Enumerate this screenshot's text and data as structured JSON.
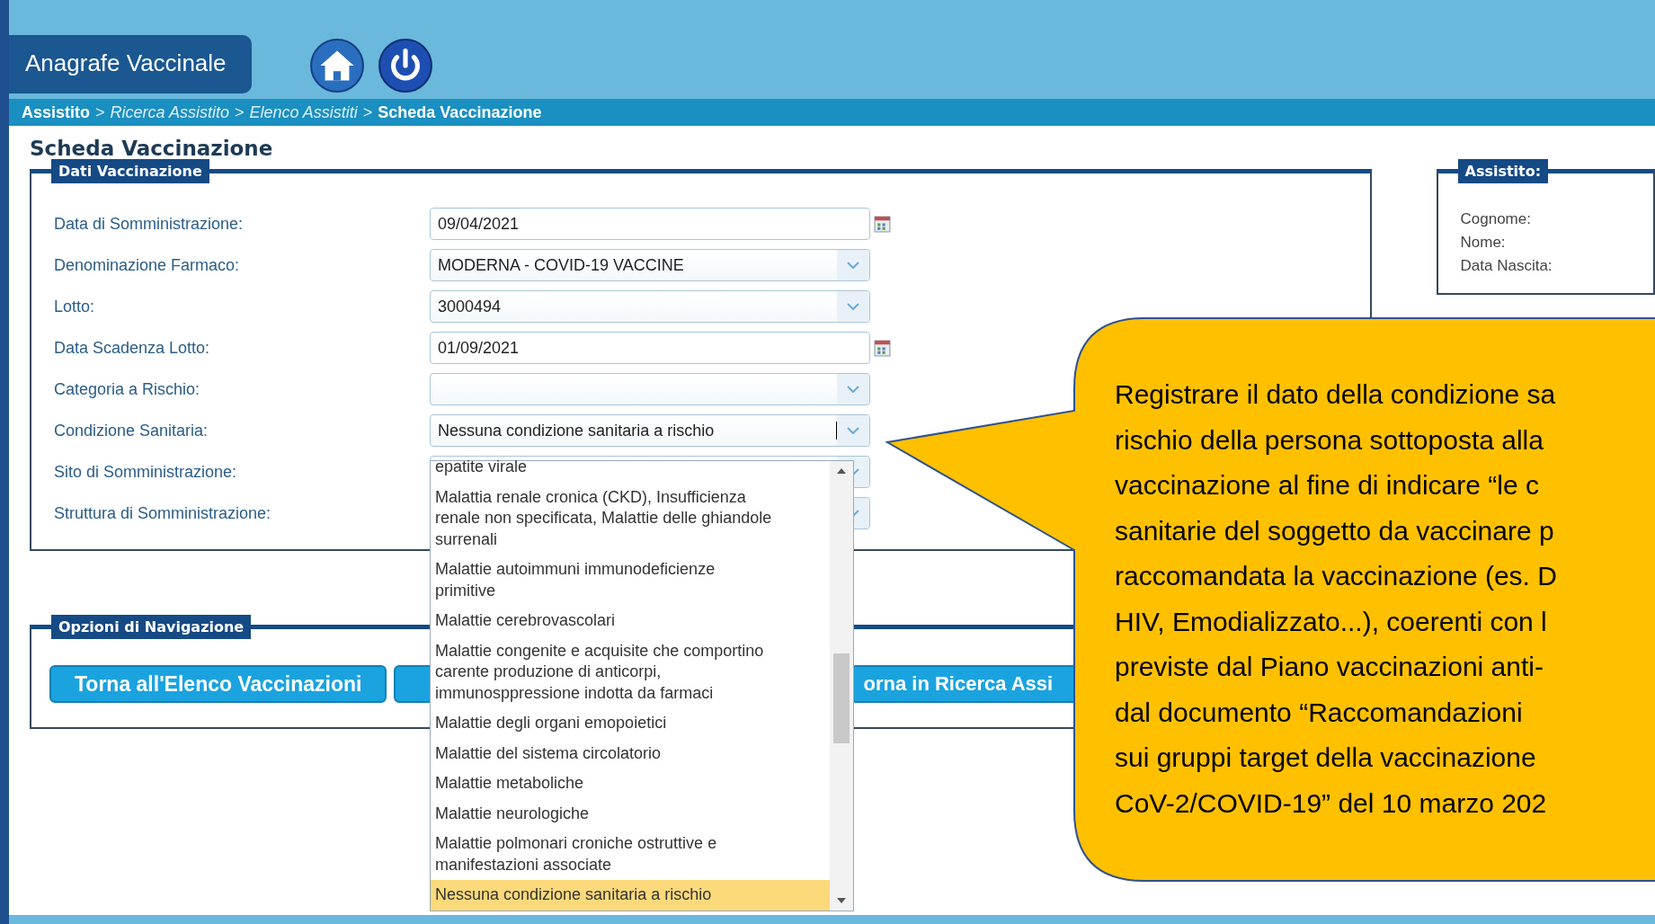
{
  "app_title": "Anagrafe Vaccinale",
  "breadcrumb": {
    "separator": ">",
    "items": [
      {
        "label": "Assistito",
        "kind": "strong"
      },
      {
        "label": "Ricerca Assistito",
        "kind": "link"
      },
      {
        "label": "Elenco Assistiti",
        "kind": "link"
      },
      {
        "label": "Scheda Vaccinazione",
        "kind": "strong"
      }
    ]
  },
  "page_title": "Scheda Vaccinazione",
  "form": {
    "legend": "Dati Vaccinazione",
    "fields": [
      {
        "label": "Data di Somministrazione:",
        "kind": "date",
        "value": "09/04/2021"
      },
      {
        "label": "Denominazione Farmaco:",
        "kind": "select",
        "value": "MODERNA - COVID-19 VACCINE"
      },
      {
        "label": "Lotto:",
        "kind": "select",
        "value": "3000494"
      },
      {
        "label": "Data Scadenza Lotto:",
        "kind": "date",
        "value": "01/09/2021"
      },
      {
        "label": "Categoria a Rischio:",
        "kind": "select"
      },
      {
        "label": "Condizione Sanitaria:",
        "kind": "combo",
        "value": "Nessuna condizione sanitaria a rischio"
      },
      {
        "label": "Sito di Somministrazione:",
        "kind": "select"
      },
      {
        "label": "Struttura di Somministrazione:",
        "kind": "select"
      }
    ]
  },
  "dropdown": {
    "options": [
      {
        "label": "epatite virale",
        "selected": false
      },
      {
        "label": "Malattia renale cronica (CKD), Insufficienza renale non specificata, Malattie delle ghiandole surrenali",
        "selected": false
      },
      {
        "label": "Malattie autoimmuni immunodeficienze primitive",
        "selected": false
      },
      {
        "label": "Malattie cerebrovascolari",
        "selected": false
      },
      {
        "label": "Malattie congenite e acquisite che comportino carente produzione di anticorpi, immunosppressione indotta da farmaci",
        "selected": false
      },
      {
        "label": "Malattie degli organi emopoietici",
        "selected": false
      },
      {
        "label": "Malattie del sistema circolatorio",
        "selected": false
      },
      {
        "label": "Malattie metaboliche",
        "selected": false
      },
      {
        "label": "Malattie neurologiche",
        "selected": false
      },
      {
        "label": "Malattie polmonari croniche ostruttive e manifestazioni associate",
        "selected": false
      },
      {
        "label": "Nessuna condizione sanitaria a rischio",
        "selected": true
      }
    ]
  },
  "assistito": {
    "legend": "Assistito:",
    "labels": [
      "Cognome:",
      "Nome:",
      "Data Nascita:"
    ]
  },
  "navigation": {
    "legend": "Opzioni di Navigazione",
    "buttons": [
      "Torna all'Elenco Vaccinazioni",
      "orna in Ricerca Assi"
    ]
  },
  "callout": {
    "lines": [
      "Registrare il dato della condizione sa",
      "rischio della persona sottoposta alla",
      "vaccinazione al fine di indicare “le c",
      "sanitarie del soggetto da vaccinare p",
      "raccomandata la vaccinazione (es. D",
      "HIV, Emodializzato...), coerenti con l",
      "previste dal Piano vaccinazioni anti-",
      "dal documento “Raccomandazioni",
      "sui gruppi target della vaccinazione",
      "CoV-2/COVID-19” del 10 marzo 202"
    ]
  }
}
